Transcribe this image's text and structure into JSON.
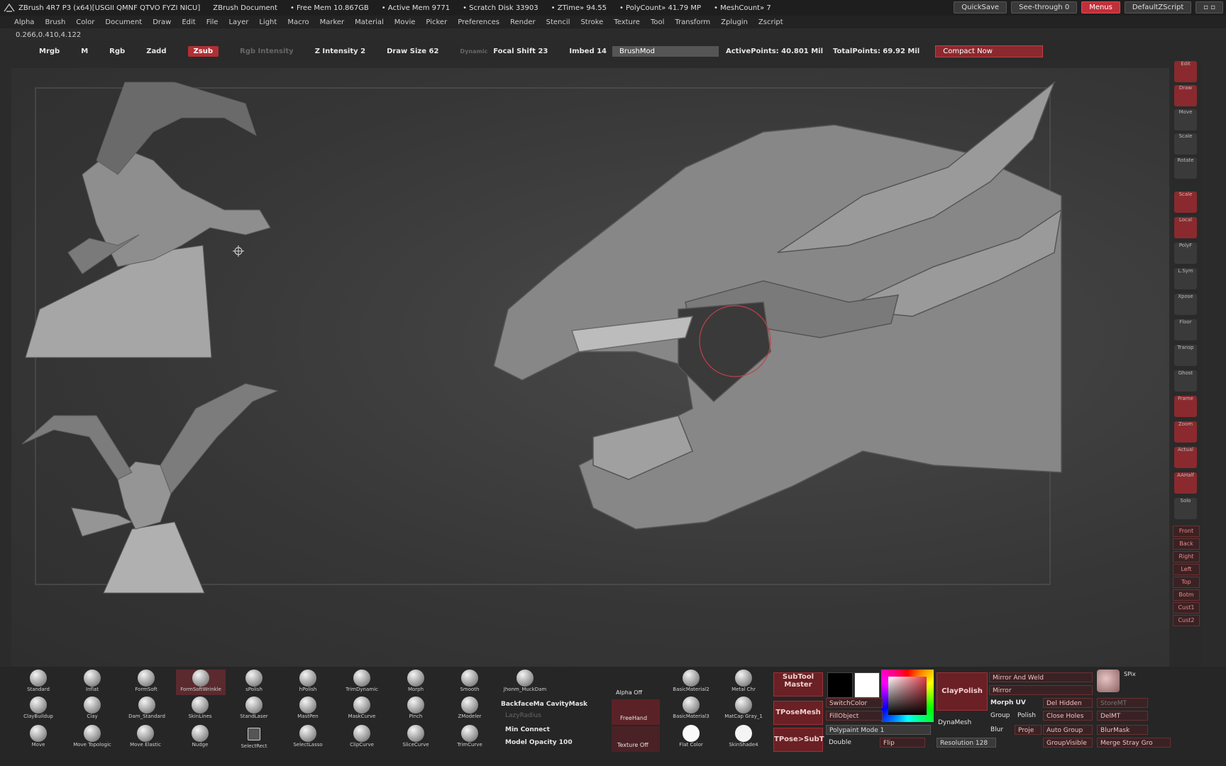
{
  "titlebar": {
    "app": "ZBrush 4R7 P3 (x64)[USGII QMNF QTVO FYZI NICU]",
    "doc": "ZBrush Document",
    "free_mem": "• Free Mem 10.867GB",
    "active_mem": "• Active Mem 9771",
    "scratch": "• Scratch Disk 33903",
    "ztime": "• ZTime» 94.55",
    "polycount": "• PolyCount» 41.79 MP",
    "meshcount": "• MeshCount» 7",
    "quicksave": "QuickSave",
    "see_through": "See-through  0",
    "menus": "Menus",
    "default_zscript": "DefaultZScript"
  },
  "menubar": [
    "Alpha",
    "Brush",
    "Color",
    "Document",
    "Draw",
    "Edit",
    "File",
    "Layer",
    "Light",
    "Macro",
    "Marker",
    "Material",
    "Movie",
    "Picker",
    "Preferences",
    "Render",
    "Stencil",
    "Stroke",
    "Texture",
    "Tool",
    "Transform",
    "Zplugin",
    "Zscript"
  ],
  "coords": "0.266,0.410,4.122",
  "toolbar": {
    "mrgb": "Mrgb",
    "m": "M",
    "rgb": "Rgb",
    "zadd": "Zadd",
    "zsub": "Zsub",
    "rgb_intensity": "Rgb Intensity",
    "z_intensity": "Z Intensity 2",
    "draw_size": "Draw Size 62",
    "dynamic": "Dynamic",
    "focal_shift": "Focal Shift 23",
    "imbed": "Imbed 14",
    "brushmod": "BrushMod",
    "active_points": "ActivePoints: 40.801 Mil",
    "total_points": "TotalPoints: 69.92 Mil",
    "compact_now": "Compact Now"
  },
  "right_shelf": {
    "buttons": [
      "Edit",
      "Draw",
      "Move",
      "Scale",
      "Rotate",
      "Scale",
      "Local",
      "PolyF",
      "L.Sym",
      "Xpose",
      "Floor",
      "Transp",
      "Ghost",
      "Frame",
      "Zoom",
      "Actual",
      "AAHalf",
      "Solo"
    ],
    "views": [
      "Front",
      "Back",
      "Right",
      "Left",
      "Top",
      "Botm",
      "Cust1",
      "Cust2"
    ]
  },
  "bottom": {
    "brushes_row1": [
      "Standard",
      "Inflat",
      "FormSoft",
      "FormSoftWrinkle",
      "sPolish",
      "hPolish",
      "TrimDynamic",
      "Morph",
      "Smooth",
      "Jhonm_MuckDam"
    ],
    "brushes_row2": [
      "ClayBuildup",
      "Clay",
      "Dam_Standard",
      "SkinLines",
      "StandLaser",
      "MastPen",
      "MaskCurve",
      "Pinch",
      "ZModeler"
    ],
    "brushes_row3": [
      "Move",
      "Move Topologic",
      "Move Elastic",
      "Nudge",
      "SelectRect",
      "SelectLasso",
      "ClipCurve",
      "SliceCurve",
      "TrimCurve"
    ],
    "backface": "BackfaceMa CavityMask",
    "lazy_radius": "LazyRadius",
    "min_connect": "Min Connect",
    "model_opacity": "Model Opacity 100",
    "alpha_off": "Alpha Off",
    "freehand": "FreeHand",
    "texture_off": "Texture Off",
    "mat1": "BasicMaterial2",
    "mat2": "BasicMaterial3",
    "mat3": "Metal Chr",
    "mat4": "MatCap Gray_1",
    "flat_color": "Flat Color",
    "skinshade": "SkinShade4",
    "subtool_master": "SubTool Master",
    "tposemesh": "TPoseMesh",
    "tpose_subt": "TPose>SubT",
    "claypolish": "ClayPolish",
    "dynamesh": "DynaMesh",
    "switchcolor": "SwitchColor",
    "fillobject": "FillObject",
    "polypaint": "Polypaint Mode 1",
    "double": "Double",
    "flip": "Flip",
    "resolution": "Resolution 128",
    "mirror_weld": "Mirror And Weld",
    "mirror": "Mirror",
    "morph_uv": "Morph UV",
    "del_hidden": "Del Hidden",
    "group": "Group",
    "polish": "Polish",
    "close_holes": "Close Holes",
    "delmt": "DelMT",
    "blur": "Blur",
    "proje": "Proje",
    "auto_group": "Auto Group",
    "blurmask": "BlurMask",
    "groupvisible": "GroupVisible",
    "merge_stray": "Merge Stray Gro",
    "storemt": "StoreMT",
    "spix": "SPix"
  }
}
